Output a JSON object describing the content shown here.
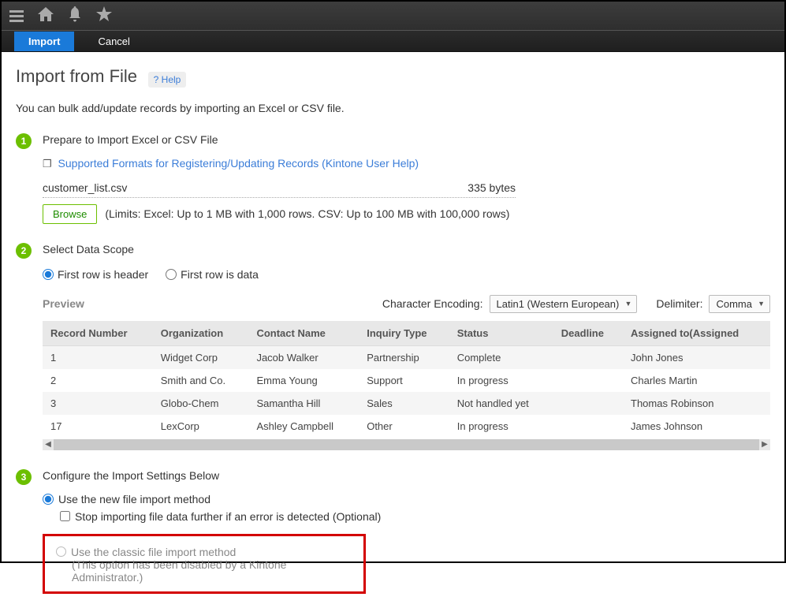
{
  "actions": {
    "import": "Import",
    "cancel": "Cancel"
  },
  "page": {
    "title": "Import from File",
    "help": "? Help",
    "subtitle": "You can bulk add/update records by importing an Excel or CSV file."
  },
  "step1": {
    "title": "Prepare to Import Excel or CSV File",
    "link": "Supported Formats for Registering/Updating Records (Kintone User Help)",
    "filename": "customer_list.csv",
    "filesize": "335 bytes",
    "browse": "Browse",
    "limits": "(Limits: Excel: Up to 1 MB with 1,000 rows. CSV: Up to 100 MB with 100,000 rows)"
  },
  "step2": {
    "title": "Select Data Scope",
    "radio_header": "First row is header",
    "radio_data": "First row is data",
    "preview_label": "Preview",
    "encoding_label": "Character Encoding:",
    "encoding_value": "Latin1 (Western European)",
    "delimiter_label": "Delimiter:",
    "delimiter_value": "Comma",
    "headers": [
      "Record Number",
      "Organization",
      "Contact Name",
      "Inquiry Type",
      "Status",
      "Deadline",
      "Assigned to(Assigned"
    ],
    "rows": [
      [
        "1",
        "Widget Corp",
        "Jacob Walker",
        "Partnership",
        "Complete",
        "",
        "John Jones"
      ],
      [
        "2",
        "Smith and Co.",
        "Emma Young",
        "Support",
        "In progress",
        "",
        "Charles Martin"
      ],
      [
        "3",
        "Globo-Chem",
        "Samantha Hill",
        "Sales",
        "Not handled yet",
        "",
        "Thomas Robinson"
      ],
      [
        "17",
        "LexCorp",
        "Ashley Campbell",
        "Other",
        "In progress",
        "",
        "James Johnson"
      ]
    ]
  },
  "step3": {
    "title": "Configure the Import Settings Below",
    "opt_new": "Use the new file import method",
    "opt_stop": "Stop importing file data further if an error is detected (Optional)",
    "opt_classic": "Use the classic file import method",
    "opt_classic_note": "(This option has been disabled by a Kintone Administrator.)"
  }
}
